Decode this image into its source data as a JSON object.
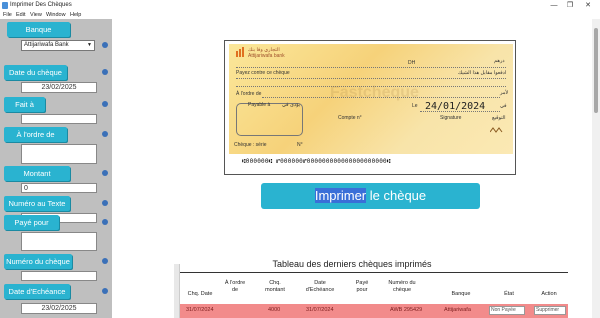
{
  "window": {
    "title": "Imprimer Des Chèques",
    "controls": [
      "—",
      "❐",
      "✕"
    ]
  },
  "menu": [
    "File",
    "Edit",
    "View",
    "Window",
    "Help"
  ],
  "sidebar": {
    "banque_label": "Banque",
    "banque_value": "Attijariwafa Bank",
    "date_cheque_label": "Date du chèque",
    "date_cheque_value": "23/02/2025",
    "fait_a_label": "Fait à",
    "fait_a_value": "",
    "ordre_label": "À l'ordre de",
    "ordre_value": "",
    "montant_label": "Montant",
    "montant_value": "0",
    "numero_texte_label": "Numéro au Texte",
    "numero_texte_value": "",
    "paye_pour_label": "Payé pour",
    "paye_pour_value": "",
    "numero_cheque_label": "Numéro du chèque",
    "numero_cheque_value": "",
    "date_echeance_label": "Date d'Echéance",
    "date_echeance_value": "23/02/2025"
  },
  "cheque": {
    "bank_name": "Attijariwafa bank",
    "bank_arabic": "التجاري وفا بنك",
    "dh_label": "DH",
    "dh_arabic": "درهم",
    "pay_label": "Payez contre ce chèque",
    "pay_arabic": "ادفعوا مقابل هذا الشيك",
    "order_label": "À l'ordre de",
    "order_arabic": "لأمر",
    "payable_label": "Payable à",
    "payable_arabic": "يؤدى في",
    "le_label": "Le",
    "date": "24/01/2024",
    "le_arabic": "في",
    "compte_label": "Compte n°",
    "signature_label": "Signature",
    "signature_arabic": "التوقيع",
    "cheque_serie_label": "Chèque : série",
    "cheque_no_label": "N°",
    "watermark": "Fastcheque",
    "micr_line": "⑆000000⑆ ⑈000000⑈000000000000000000000⑆"
  },
  "print_button": {
    "highlight": "Imprimer",
    "rest": " le chèque"
  },
  "table": {
    "title": "Tableau des derniers chèques imprimés",
    "headers": [
      "Chq. Date",
      "À l'ordre de",
      "Chq. montant",
      "Date d'Echéance",
      "Payé pour",
      "Numéro du chèque",
      "Banque",
      "État",
      "Action"
    ],
    "row": {
      "chq_date": "31/07/2024",
      "montant": "4000",
      "echeance": "31/07/2024",
      "numero": "AWB 295429",
      "banque": "Attijariwafa",
      "etat": "Non Payée",
      "action": "Supprimer"
    }
  },
  "colors": {
    "accent": "#2ab3d0",
    "sidebar_bg": "#bfbfbf",
    "row_highlight": "#f28b8b",
    "dot": "#3a70b8"
  }
}
